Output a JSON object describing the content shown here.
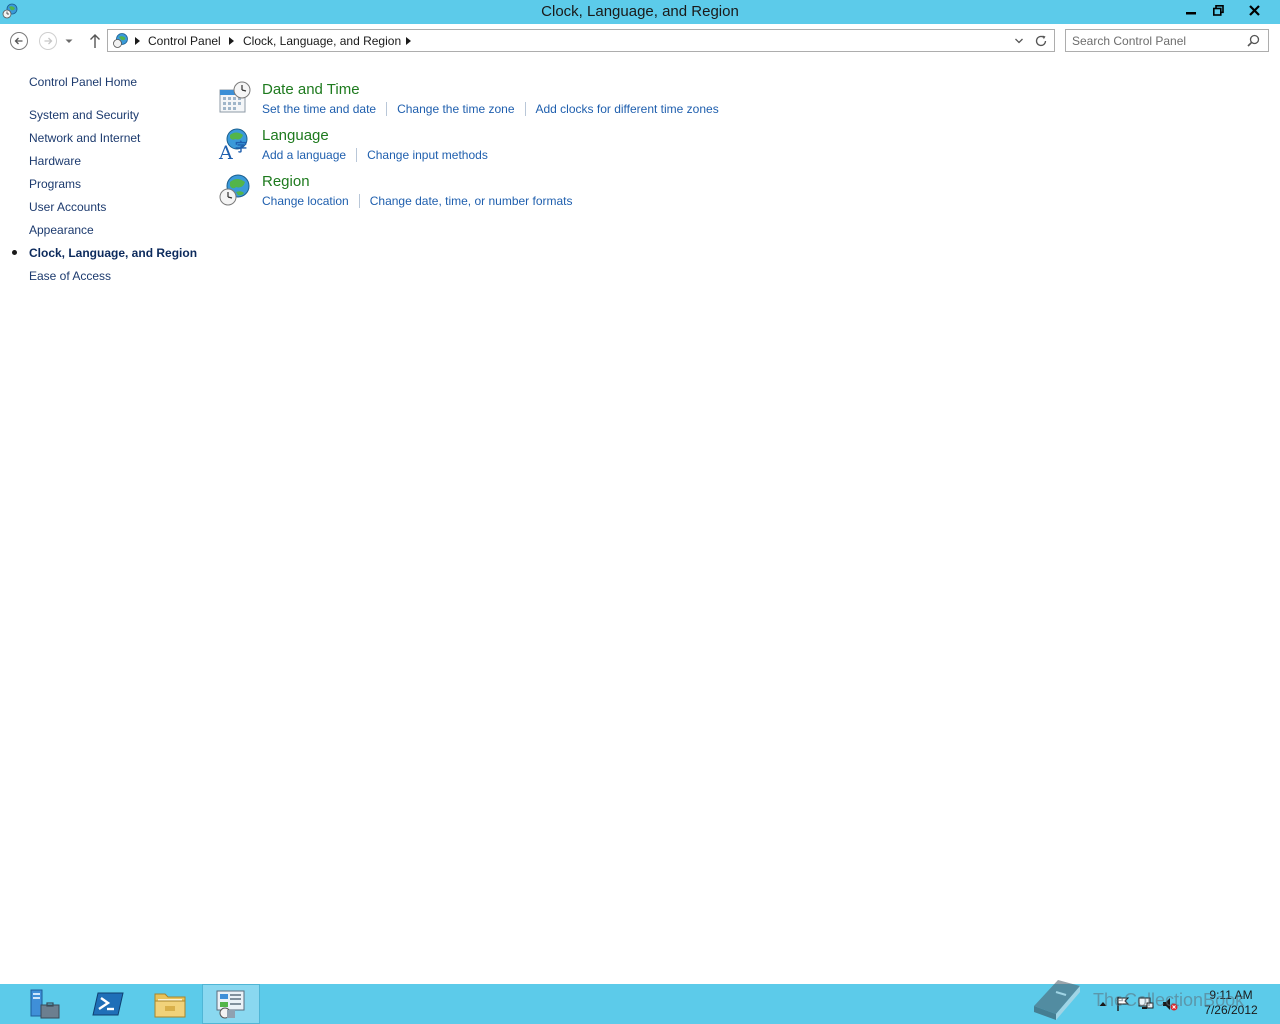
{
  "window": {
    "title": "Clock, Language, and Region",
    "controls": {
      "minimize": "▁",
      "maximize": "❐",
      "close": "✕"
    }
  },
  "nav": {
    "icons": {
      "back": "back-arrow-icon",
      "forward": "forward-arrow-icon",
      "recent": "chevron-down-icon",
      "up": "up-arrow-icon"
    },
    "breadcrumb": [
      "Control Panel",
      "Clock, Language, and Region"
    ],
    "search_placeholder": "Search Control Panel"
  },
  "sidebar": {
    "home": "Control Panel Home",
    "items": [
      {
        "label": "System and Security"
      },
      {
        "label": "Network and Internet"
      },
      {
        "label": "Hardware"
      },
      {
        "label": "Programs"
      },
      {
        "label": "User Accounts"
      },
      {
        "label": "Appearance"
      },
      {
        "label": "Clock, Language, and Region",
        "active": true
      },
      {
        "label": "Ease of Access"
      }
    ]
  },
  "categories": [
    {
      "title": "Date and Time",
      "icon": "calendar-clock-icon",
      "links": [
        "Set the time and date",
        "Change the time zone",
        "Add clocks for different time zones"
      ]
    },
    {
      "title": "Language",
      "icon": "language-globe-icon",
      "links": [
        "Add a language",
        "Change input methods"
      ]
    },
    {
      "title": "Region",
      "icon": "region-globe-clock-icon",
      "links": [
        "Change location",
        "Change date, time, or number formats"
      ]
    }
  ],
  "taskbar": {
    "apps": [
      "server-manager-icon",
      "powershell-icon",
      "file-explorer-icon",
      "control-panel-icon"
    ],
    "clock": {
      "time": "9:11 AM",
      "date": "7/26/2012"
    },
    "watermark": "TheCollectionBook"
  },
  "colors": {
    "titlebar": "#5ccbea",
    "category_title": "#1e7a1e",
    "link": "#1f5fae",
    "nav_text": "#1c3a6e"
  }
}
